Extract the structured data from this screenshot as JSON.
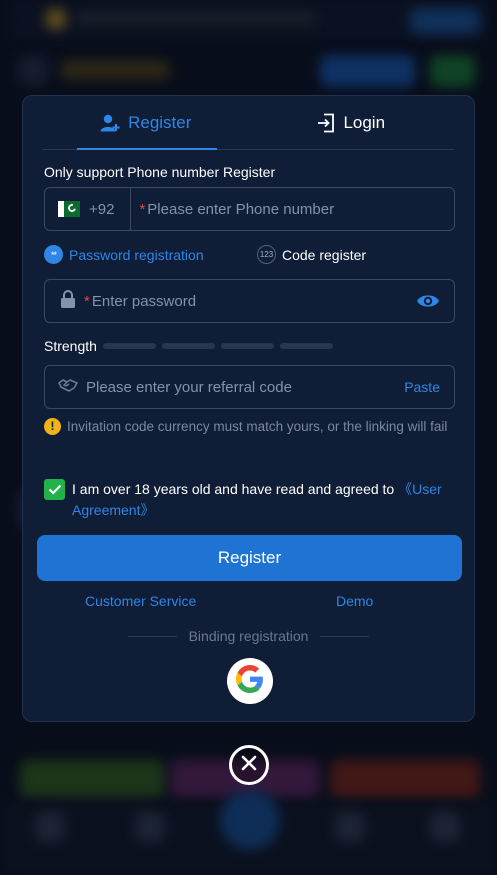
{
  "tabs": {
    "register": "Register",
    "login": "Login"
  },
  "section_title": "Only support Phone number Register",
  "phone": {
    "country_code": "+92",
    "required_mark": "*",
    "placeholder": "Please enter Phone number"
  },
  "registration_options": {
    "password": "Password registration",
    "password_icon_text": "**",
    "code": "Code register",
    "code_icon_text": "123"
  },
  "password": {
    "required_mark": "*",
    "placeholder": "Enter password"
  },
  "strength_label": "Strength",
  "referral": {
    "placeholder": "Please enter your referral code",
    "paste_label": "Paste"
  },
  "notice": {
    "icon_text": "!",
    "text": "Invitation code currency must match yours, or the linking will fail"
  },
  "agreement": {
    "text": "I am over 18 years old and have read and agreed to ",
    "link": "《User Agreement》",
    "checked": true
  },
  "register_button": "Register",
  "links": {
    "customer_service": "Customer Service",
    "demo": "Demo"
  },
  "binding_label": "Binding registration",
  "colors": {
    "accent": "#2f86e6",
    "button": "#1f74d3",
    "modal_bg": "#0f1d36",
    "required": "#e04a4a",
    "check": "#21b24a",
    "warn": "#f0b31a"
  }
}
